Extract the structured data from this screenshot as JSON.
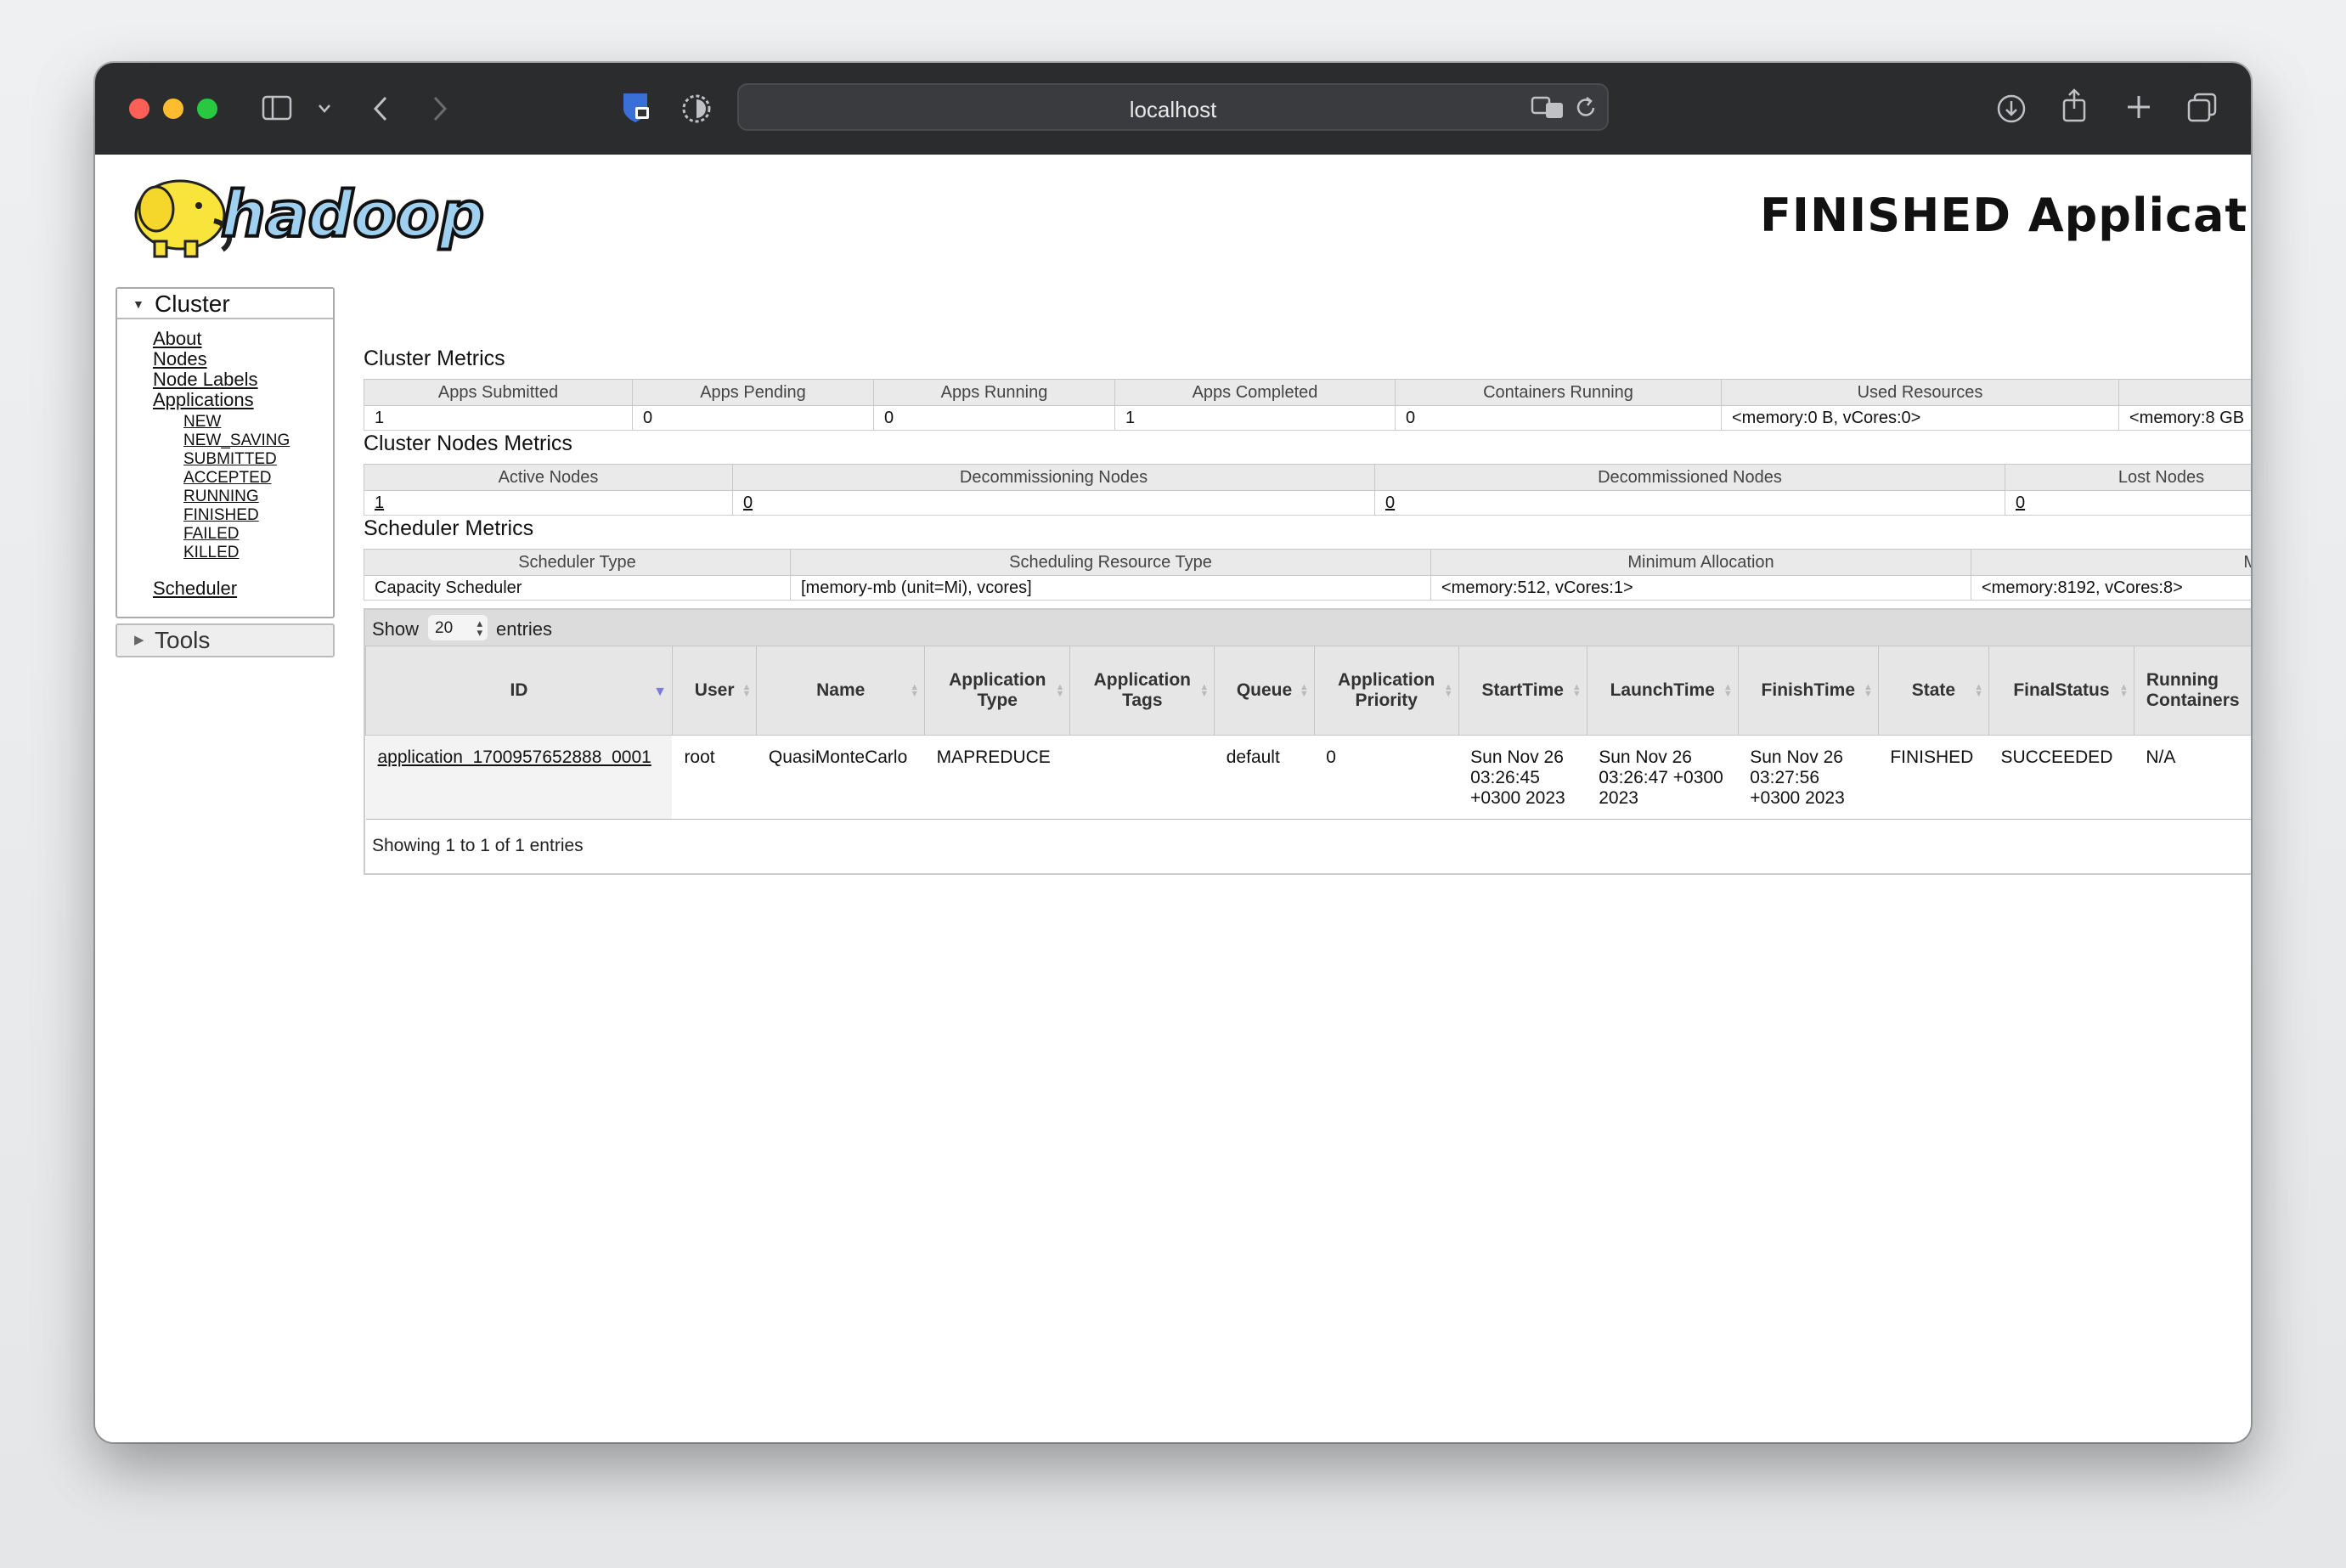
{
  "browser": {
    "url": "localhost"
  },
  "header": {
    "title": "FINISHED Applications",
    "logo_text": "hadoop"
  },
  "sidebar": {
    "cluster_label": "Cluster",
    "links": [
      "About",
      "Nodes",
      "Node Labels",
      "Applications"
    ],
    "app_states": [
      "NEW",
      "NEW_SAVING",
      "SUBMITTED",
      "ACCEPTED",
      "RUNNING",
      "FINISHED",
      "FAILED",
      "KILLED"
    ],
    "scheduler_label": "Scheduler",
    "tools_label": "Tools"
  },
  "cluster_metrics": {
    "title": "Cluster Metrics",
    "headers": [
      "Apps Submitted",
      "Apps Pending",
      "Apps Running",
      "Apps Completed",
      "Containers Running",
      "Used Resources",
      ""
    ],
    "values": [
      "1",
      "0",
      "0",
      "1",
      "0",
      "<memory:0 B, vCores:0>",
      "<memory:8 GB"
    ]
  },
  "nodes_metrics": {
    "title": "Cluster Nodes Metrics",
    "headers": [
      "Active Nodes",
      "Decommissioning Nodes",
      "Decommissioned Nodes",
      "Lost Nodes"
    ],
    "values": [
      "1",
      "0",
      "0",
      "0"
    ]
  },
  "scheduler_metrics": {
    "title": "Scheduler Metrics",
    "headers": [
      "Scheduler Type",
      "Scheduling Resource Type",
      "Minimum Allocation",
      "Maximum"
    ],
    "values": [
      "Capacity Scheduler",
      "[memory-mb (unit=Mi), vcores]",
      "<memory:512, vCores:1>",
      "<memory:8192, vCores:8>"
    ]
  },
  "apps": {
    "show_label": "Show",
    "page_size": "20",
    "entries_label": "entries",
    "columns": [
      "ID",
      "User",
      "Name",
      "Application Type",
      "Application Tags",
      "Queue",
      "Application Priority",
      "StartTime",
      "LaunchTime",
      "FinishTime",
      "State",
      "FinalStatus",
      "Running Containers"
    ],
    "rows": [
      [
        "application_1700957652888_0001",
        "root",
        "QuasiMonteCarlo",
        "MAPREDUCE",
        "",
        "default",
        "0",
        "Sun Nov 26 03:26:45 +0300 2023",
        "Sun Nov 26 03:26:47 +0300 2023",
        "Sun Nov 26 03:27:56 +0300 2023",
        "FINISHED",
        "SUCCEEDED",
        "N/A"
      ]
    ],
    "showing": "Showing 1 to 1 of 1 entries"
  }
}
